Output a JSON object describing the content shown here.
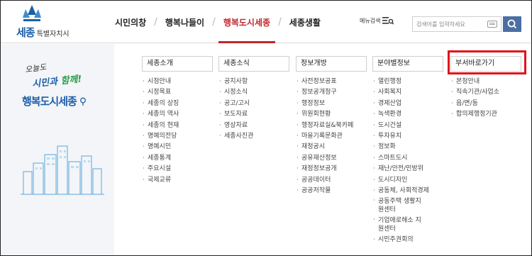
{
  "header": {
    "logo_text": "세종",
    "logo_sub": "특별자치시",
    "nav": [
      "시민의창",
      "행복나들이",
      "행복도시세종",
      "세종생활"
    ],
    "active_nav_index": 2,
    "menu_search_label": "메뉴검색",
    "search_placeholder": "검색어를 입력하세요"
  },
  "left_panel": {
    "slogan_small": "오늘도",
    "slogan_mid_a": "시민과 ",
    "slogan_mid_b": "함께!",
    "slogan_big": "행복도시세종"
  },
  "columns": [
    {
      "title": "세종소개",
      "items": [
        "시청안내",
        "시정목표",
        "세종의 상징",
        "세종의 역사",
        "세종의 현재",
        "명예의전당",
        "명예시민",
        "세종통계",
        "주요시설",
        "국제교류"
      ]
    },
    {
      "title": "세종소식",
      "items": [
        "공지사항",
        "시정소식",
        "공고/고시",
        "보도자료",
        "영상자료",
        "세종사진관"
      ]
    },
    {
      "title": "정보개방",
      "items": [
        "사전정보공표",
        "정보공개청구",
        "행정정보",
        "위원회현황",
        "행정자료실&북카페",
        "마을기록문화관",
        "재정공시",
        "공유재산정보",
        "재정정보공개",
        "공공데이터",
        "공공저작물"
      ]
    },
    {
      "title": "분야별정보",
      "items": [
        "열린행정",
        "사회복지",
        "경제산업",
        "녹색환경",
        "도시건설",
        "투자유치",
        "정보화",
        "스마트도시",
        "재난/안전/민방위",
        "도시디자인",
        "공동체, 사회적경제",
        "공동주택 생활지원센터",
        "기업애로해소 지원센터",
        "시민주권회의"
      ]
    },
    {
      "title": "부서바로가기",
      "items": [
        "본청안내",
        "직속기관/사업소",
        "읍/면/동",
        "합의제행정기관"
      ]
    }
  ],
  "colors": {
    "accent_red": "#c1272d",
    "brand_blue": "#1d5fa8",
    "highlight": "#e0141a"
  }
}
